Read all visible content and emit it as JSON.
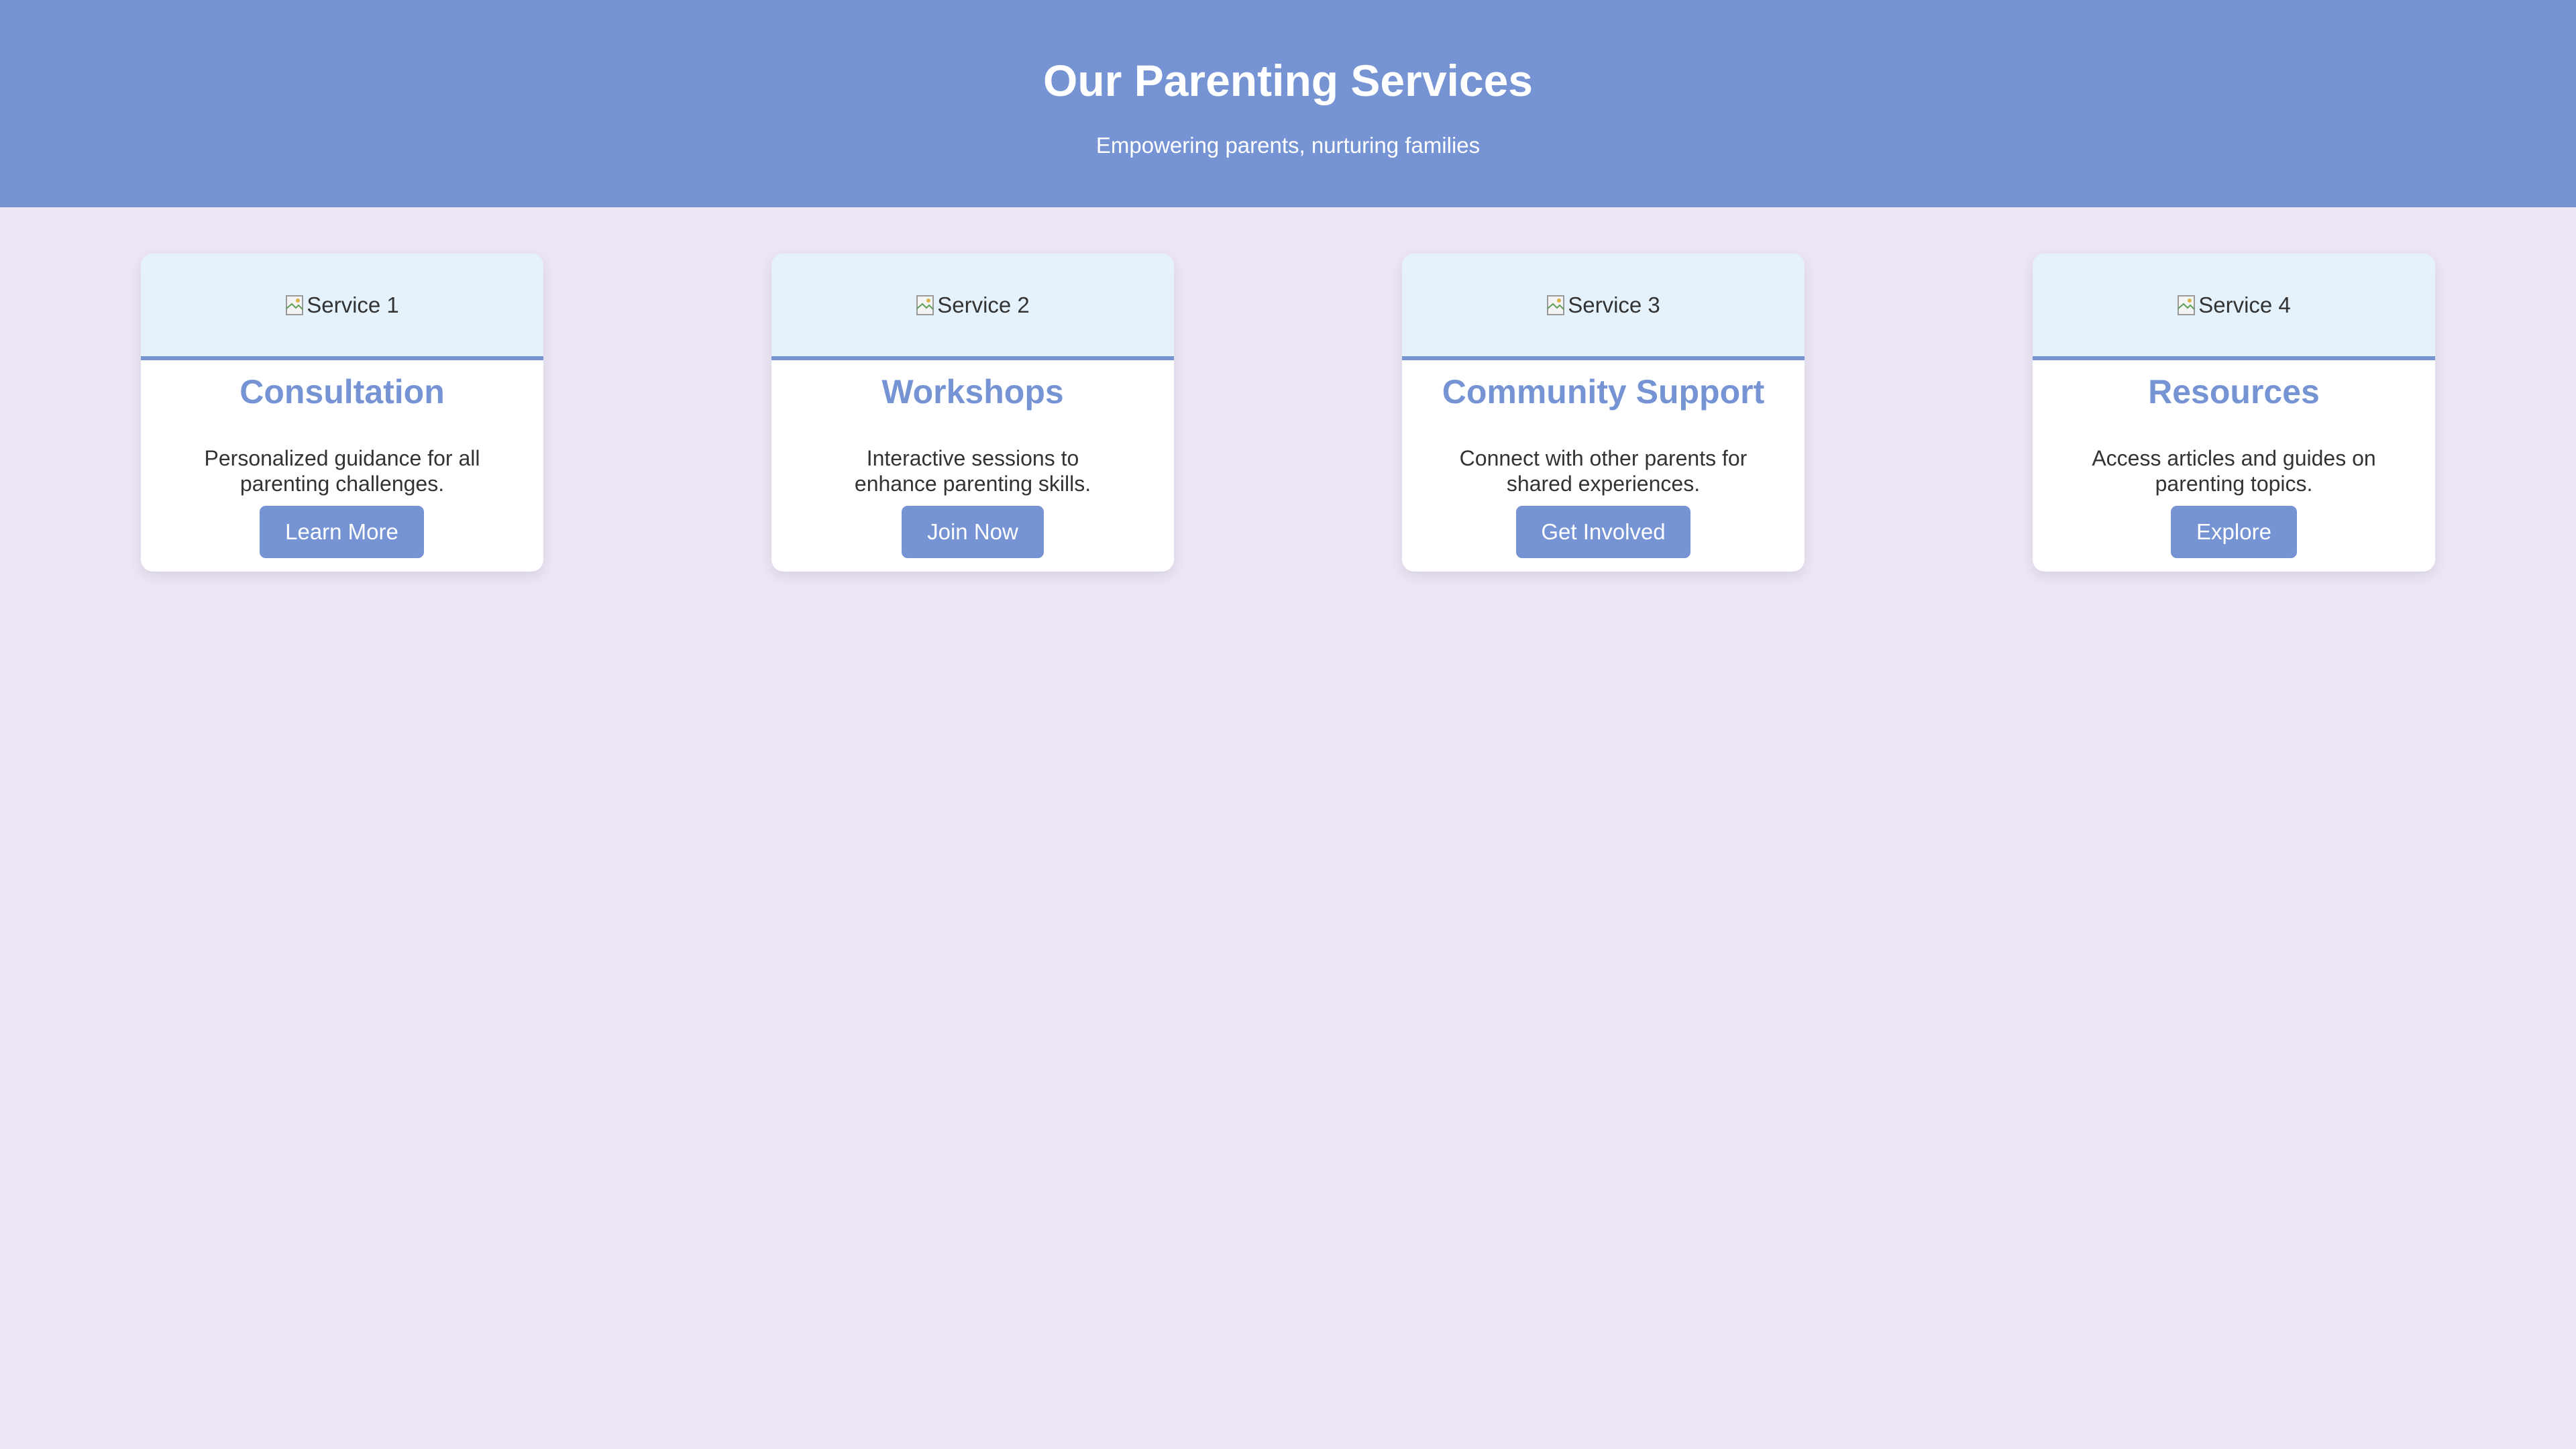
{
  "header": {
    "title": "Our Parenting Services",
    "subtitle": "Empowering parents, nurturing families"
  },
  "services": [
    {
      "image_alt": "Service 1",
      "title": "Consultation",
      "description": "Personalized guidance for all parenting challenges.",
      "button_label": "Learn More"
    },
    {
      "image_alt": "Service 2",
      "title": "Workshops",
      "description": "Interactive sessions to enhance parenting skills.",
      "button_label": "Join Now"
    },
    {
      "image_alt": "Service 3",
      "title": "Community Support",
      "description": "Connect with other parents for shared experiences.",
      "button_label": "Get Involved"
    },
    {
      "image_alt": "Service 4",
      "title": "Resources",
      "description": "Access articles and guides on parenting topics.",
      "button_label": "Explore"
    }
  ],
  "colors": {
    "accent": "#7694d4",
    "background": "#ede6f4",
    "card_image_bg": "#e5f1fb",
    "card_bg": "#ffffff",
    "text": "#333333"
  },
  "icons": {
    "image_placeholder": "broken-image-icon"
  }
}
